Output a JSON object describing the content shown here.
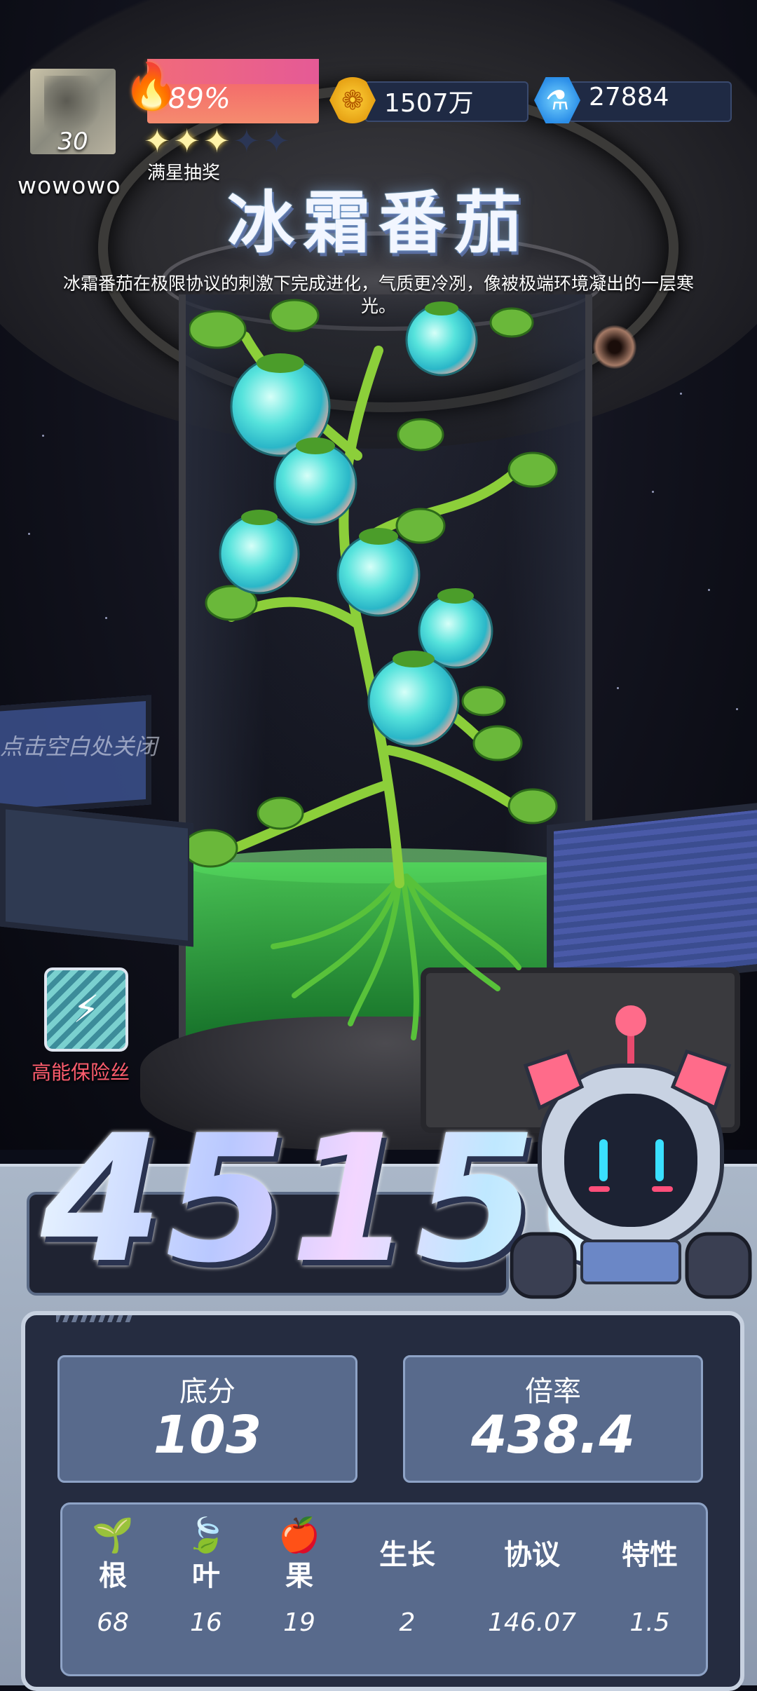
{
  "player": {
    "level": "30",
    "username": "wowowo",
    "energy_percent": "89%",
    "stars_filled": 3,
    "stars_total": 5,
    "stars_label": "满星抽奖"
  },
  "resources": {
    "coins": "1507万",
    "gems": "27884"
  },
  "item": {
    "name": "冰霜番茄",
    "description": "冰霜番茄在极限协议的刺激下完成进化，气质更冷冽，像被极端环境凝出的一层寒光。"
  },
  "hints": {
    "close": "点击空白处关闭",
    "fuse_label": "高能保险丝"
  },
  "score": {
    "total": "45156",
    "base_label": "底分",
    "base_value": "103",
    "multiplier_label": "倍率",
    "multiplier_value": "438.4"
  },
  "breakdown": {
    "root_label": "根",
    "root_value": "68",
    "leaf_label": "叶",
    "leaf_value": "16",
    "fruit_label": "果",
    "fruit_value": "19",
    "growth_label": "生长",
    "growth_value": "2",
    "protocol_label": "协议",
    "protocol_value": "146.07",
    "trait_label": "特性",
    "trait_value": "1.5"
  },
  "icons": {
    "energy": "flame-icon",
    "coins": "coin-icon",
    "gems": "gem-icon",
    "fuse": "fuse-icon",
    "root": "root-icon",
    "leaf": "leaf-icon",
    "fruit": "fruit-icon"
  },
  "colors": {
    "energy_bar": "#f45a6a",
    "fuse_label": "#ff5d6e",
    "panel_bg": "#252c40",
    "card_bg": "#586a8c"
  }
}
